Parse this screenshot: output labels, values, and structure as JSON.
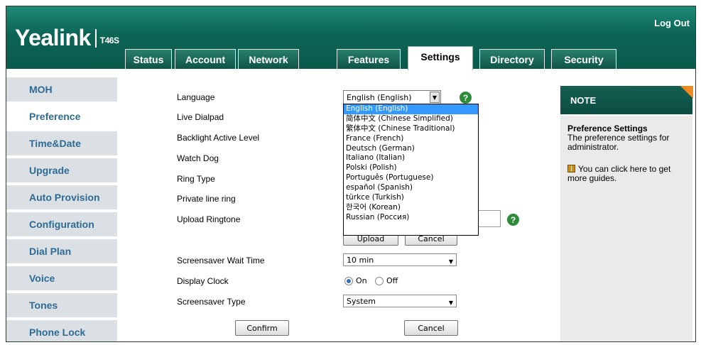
{
  "header": {
    "brand": "Yealink",
    "model": "T46S",
    "logout": "Log Out"
  },
  "tabs": [
    {
      "label": "Status"
    },
    {
      "label": "Account"
    },
    {
      "label": "Network"
    },
    {
      "label": "Features"
    },
    {
      "label": "Settings",
      "active": true
    },
    {
      "label": "Directory"
    },
    {
      "label": "Security"
    }
  ],
  "sidebar": {
    "items": [
      {
        "label": "MOH"
      },
      {
        "label": "Preference",
        "active": true
      },
      {
        "label": "Time&Date"
      },
      {
        "label": "Upgrade"
      },
      {
        "label": "Auto Provision"
      },
      {
        "label": "Configuration"
      },
      {
        "label": "Dial Plan"
      },
      {
        "label": "Voice"
      },
      {
        "label": "Tones"
      },
      {
        "label": "Phone Lock"
      }
    ]
  },
  "form": {
    "labels": {
      "language": "Language",
      "live_dialpad": "Live Dialpad",
      "backlight": "Backlight Active Level",
      "watch_dog": "Watch Dog",
      "ring_type": "Ring Type",
      "private_line_ring": "Private line ring",
      "upload_ringtone": "Upload Ringtone",
      "screensaver_wait": "Screensaver Wait Time",
      "display_clock": "Display Clock",
      "screensaver_type": "Screensaver Type"
    },
    "language_value": "English (English)",
    "language_options": [
      "English (English)",
      "简体中文 (Chinese Simplified)",
      "繁体中文 (Chinese Traditional)",
      "France (French)",
      "Deutsch (German)",
      "Italiano (Italian)",
      "Polski (Polish)",
      "Português (Portuguese)",
      "español (Spanish)",
      "türkce (Turkish)",
      "한국어 (Korean)",
      "Russian (Россия)"
    ],
    "upload_label": "Upload",
    "upload_cancel_label": "Cancel",
    "screensaver_wait_value": "10 min",
    "clock_on": "On",
    "clock_off": "Off",
    "clock_selected": "On",
    "screensaver_type_value": "System",
    "confirm_label": "Confirm",
    "cancel_label": "Cancel"
  },
  "note": {
    "heading": "NOTE",
    "title": "Preference Settings",
    "text": "The preference settings for administrator.",
    "guide": "You can click here to get more guides."
  },
  "colors": {
    "header_green": "#0c6455",
    "sidebar_link": "#2f6a93",
    "help_icon": "#2e8b3a",
    "note_corner": "#f08a1c",
    "highlight": "#3399ff"
  }
}
